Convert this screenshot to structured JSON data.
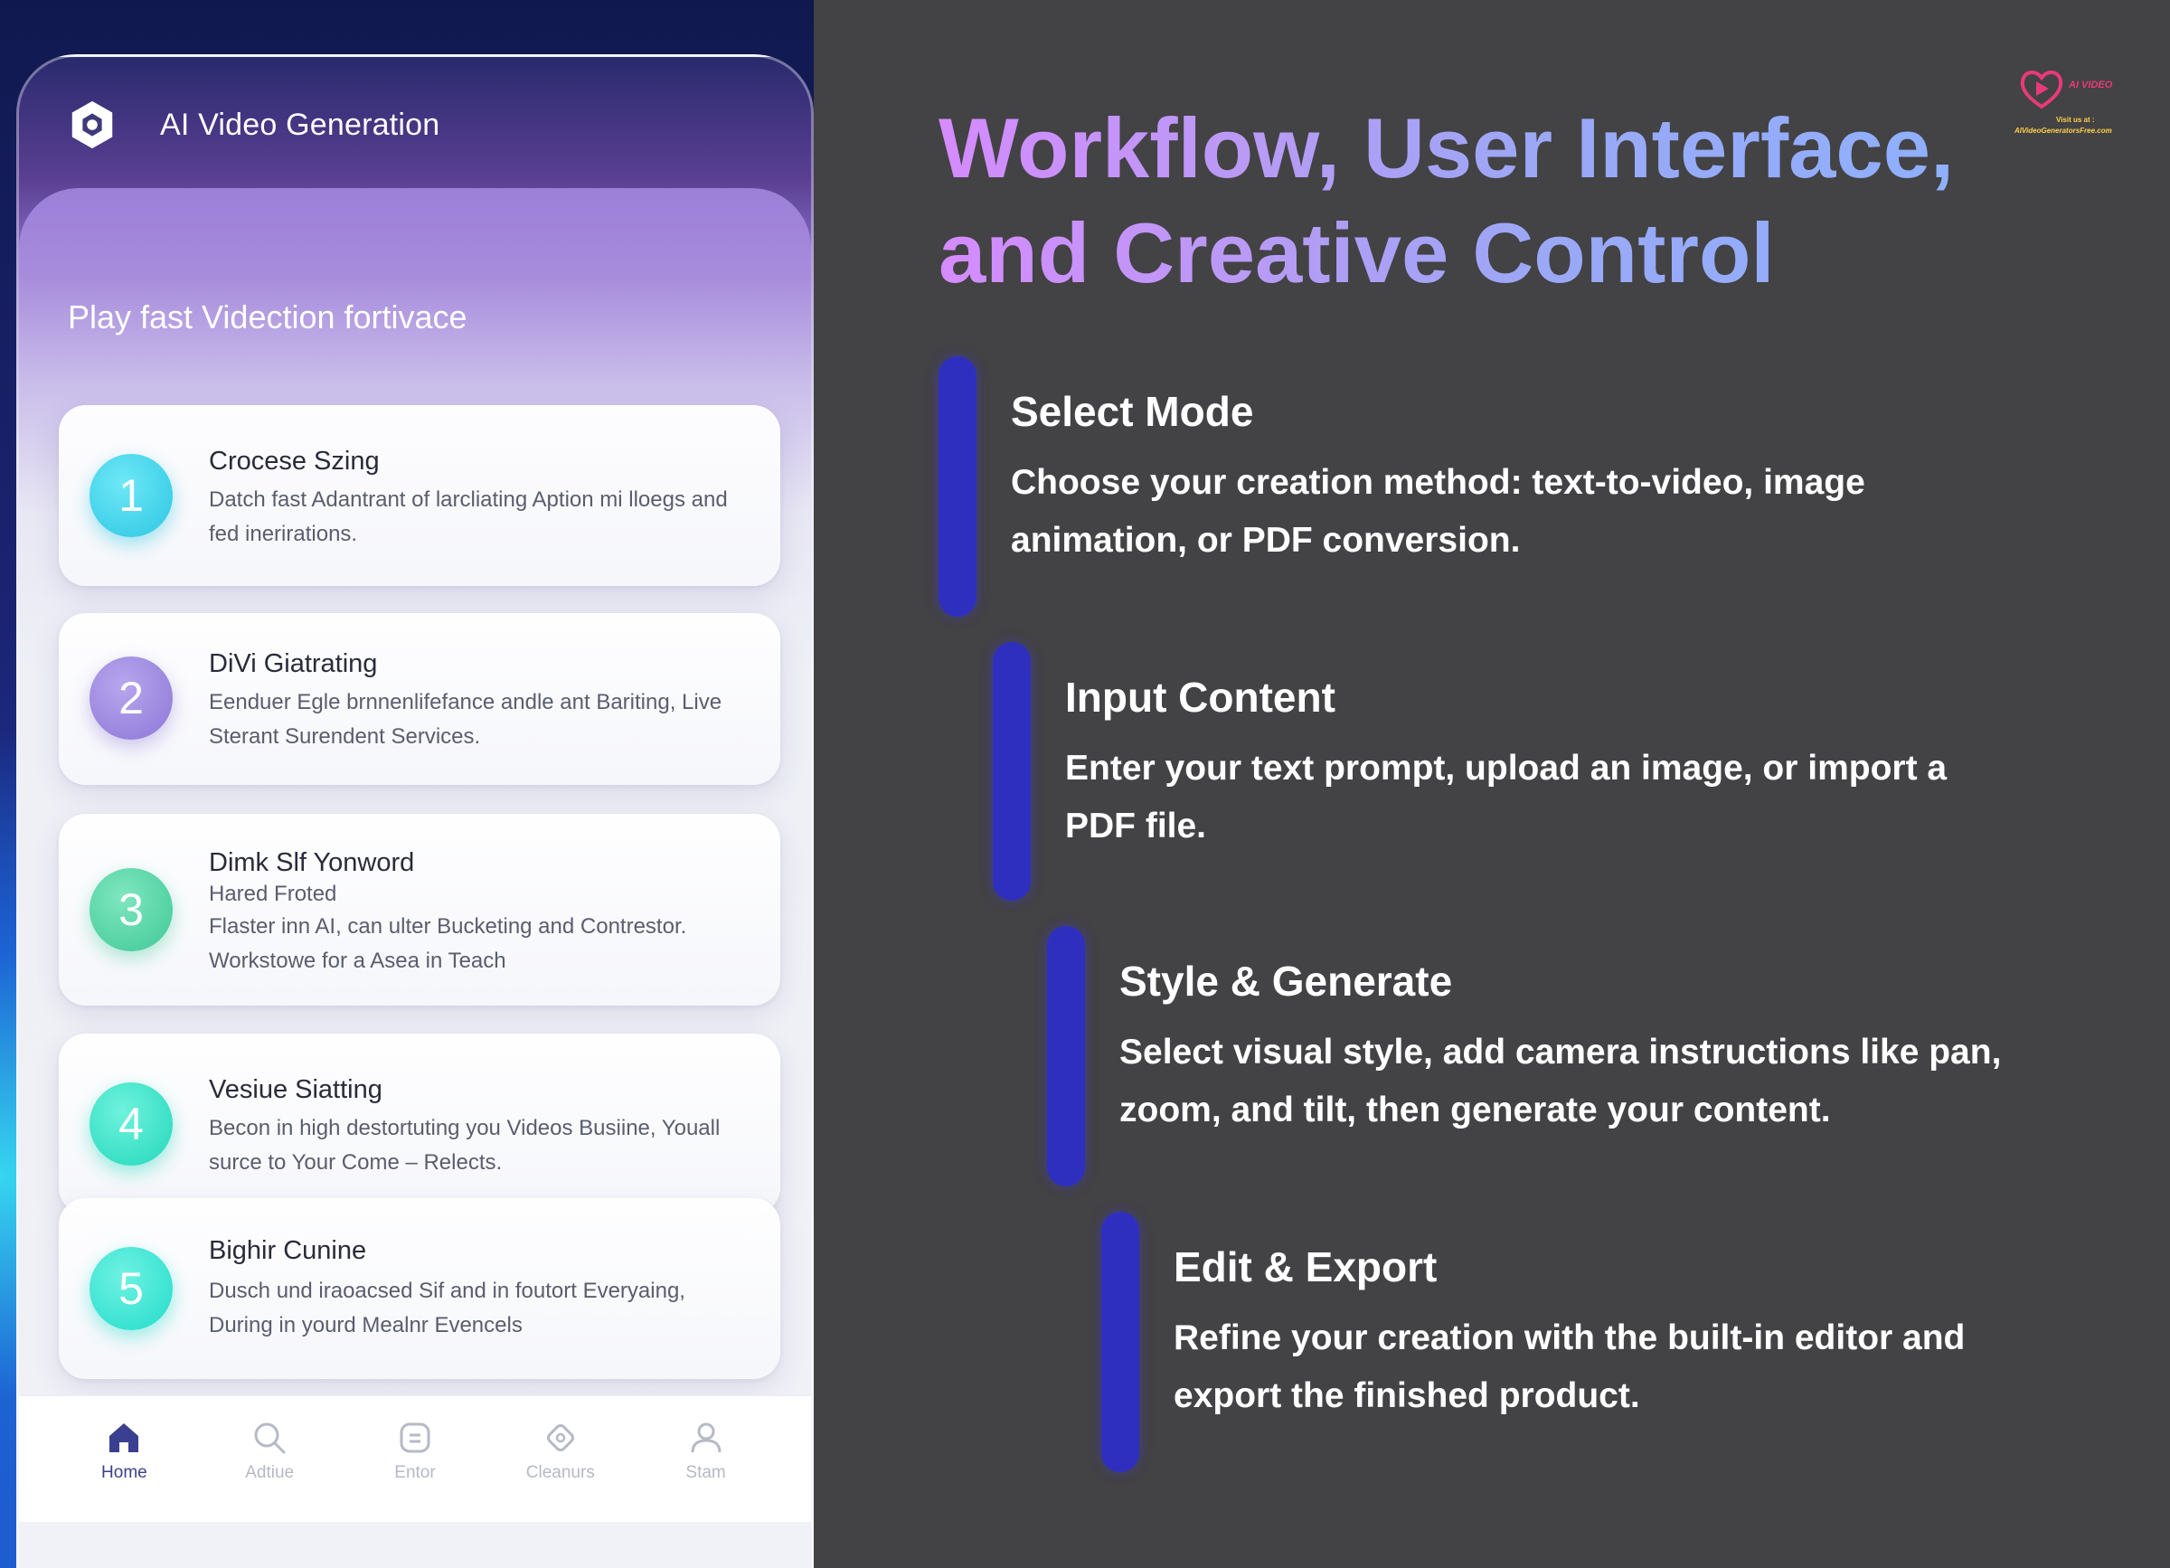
{
  "app": {
    "title": "AI Video Generation",
    "subtitle": "Play fast Videction fortivace"
  },
  "steps": [
    {
      "number": "1",
      "title": "Crocese Szing",
      "description": "Datch fast Adantrant of larcliating Aption mi lloegs and fed inerirations."
    },
    {
      "number": "2",
      "title": "DiVi Giatrating",
      "description": "Eenduer Egle brnnenlifefance andle ant Bariting, Live Sterant Surendent Services."
    },
    {
      "number": "3",
      "title": "Dimk Slf Yonword",
      "subtitle": "Hared Froted",
      "description": "Flaster inn AI, can ulter Bucketing and Contrestor. Workstowe for a Asea in Teach"
    },
    {
      "number": "4",
      "title": "Vesiue Siatting",
      "description": "Becon in high destortuting you Videos Busiine, Youall surce to Your Come – Relects."
    },
    {
      "number": "5",
      "title": "Bighir Cunine",
      "description": "Dusch und iraoacsed Sif and in foutort Everyaing, During in yourd Mealnr Evencels"
    }
  ],
  "nav": [
    {
      "label": "Home",
      "icon": "home-icon",
      "active": true
    },
    {
      "label": "Adtiue",
      "icon": "search-icon",
      "active": false
    },
    {
      "label": "Entor",
      "icon": "clipboard-icon",
      "active": false
    },
    {
      "label": "Cleanurs",
      "icon": "diamond-icon",
      "active": false
    },
    {
      "label": "Stam",
      "icon": "user-icon",
      "active": false
    }
  ],
  "headline": {
    "line1": "Workflow, User Interface,",
    "line2": "and Creative Control"
  },
  "brand": {
    "name": "AI VIDEO",
    "tagline": "Visit us at :",
    "url": "AIVideoGeneratorsFree.com"
  },
  "workflow": [
    {
      "title": "Select Mode",
      "description": "Choose your creation method: text-to-video, image animation, or PDF conversion."
    },
    {
      "title": "Input Content",
      "description": "Enter your text prompt, upload an image, or import a PDF file."
    },
    {
      "title": "Style & Generate",
      "description": "Select visual style, add camera instructions like pan, zoom, and tilt, then generate your content."
    },
    {
      "title": "Edit & Export",
      "description": "Refine your creation with the built-in editor and export the finished product."
    }
  ],
  "colors": {
    "step1": "#3fd3ea",
    "step2": "#9b86dc",
    "step3": "#4fd3a2",
    "step4": "#2fe0c8",
    "step5": "#2fe0cf",
    "accent_bar": "#2f2fbf",
    "right_bg": "#434244"
  }
}
